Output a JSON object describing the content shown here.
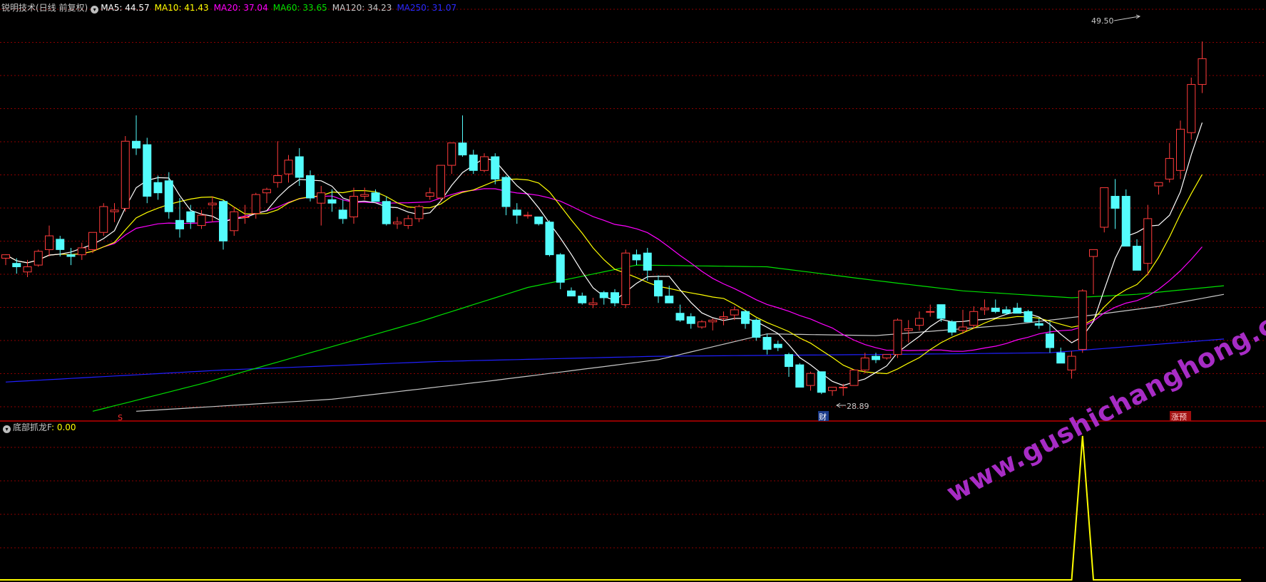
{
  "colors": {
    "up": "#ff3b3b",
    "down": "#54fcfc",
    "grid": "#8b0000",
    "ma5": "#ffffff",
    "ma10": "#ffff00",
    "ma20": "#ff00ff",
    "ma60": "#00e000",
    "ma120": "#c8c8c8",
    "ma250": "#2020ff",
    "indicator": "#ffff00",
    "watermark": "#b02fd0"
  },
  "header": {
    "title": "锐明技术(日线 前复权)",
    "ma5": "MA5: 44.57",
    "ma10": "MA10: 41.43",
    "ma20": "MA20: 37.04",
    "ma60": "MA60: 33.65",
    "ma120": "MA120: 34.23",
    "ma250": "MA250: 31.07"
  },
  "indicator_header": {
    "title": "底部抓龙F",
    "value": ": 0.00"
  },
  "annotations": {
    "high_label": "49.50",
    "low_label": "28.89",
    "marker_s": "S",
    "marker_cai": "财",
    "marker_zhangyu": "涨预"
  },
  "icons": {
    "header_toggle": "circle-down-icon",
    "indicator_toggle": "circle-down-icon"
  },
  "watermark": "www.gushichanghong.com",
  "chart_data": {
    "type": "candlestick",
    "price_range": [
      27.6,
      51.0
    ],
    "grid": true,
    "candles": [
      [
        36.9,
        37.1,
        36.5,
        37.1
      ],
      [
        36.6,
        36.9,
        36.0,
        36.4
      ],
      [
        36.1,
        36.8,
        35.8,
        36.4
      ],
      [
        36.5,
        37.4,
        36.4,
        37.3
      ],
      [
        37.4,
        38.8,
        37.0,
        38.2
      ],
      [
        38.0,
        38.2,
        37.0,
        37.4
      ],
      [
        37.1,
        37.5,
        36.5,
        37.0
      ],
      [
        37.1,
        37.8,
        36.8,
        37.5
      ],
      [
        37.4,
        38.4,
        37.2,
        38.4
      ],
      [
        38.4,
        40.1,
        38.2,
        39.9
      ],
      [
        39.6,
        40.1,
        39.0,
        39.7
      ],
      [
        39.8,
        44.0,
        39.6,
        43.7
      ],
      [
        43.7,
        45.2,
        42.9,
        43.3
      ],
      [
        43.5,
        43.9,
        40.1,
        40.5
      ],
      [
        41.3,
        41.7,
        40.3,
        40.7
      ],
      [
        41.4,
        41.9,
        39.2,
        39.6
      ],
      [
        39.1,
        40.4,
        38.1,
        38.6
      ],
      [
        39.6,
        40.0,
        38.6,
        39.0
      ],
      [
        38.8,
        39.7,
        38.6,
        39.4
      ],
      [
        40.0,
        40.5,
        39.0,
        40.1
      ],
      [
        40.2,
        40.3,
        37.4,
        37.9
      ],
      [
        38.5,
        39.9,
        38.2,
        39.6
      ],
      [
        39.3,
        40.0,
        38.9,
        39.3
      ],
      [
        39.5,
        40.7,
        39.2,
        40.6
      ],
      [
        40.7,
        41.0,
        40.1,
        40.9
      ],
      [
        41.3,
        43.7,
        41.0,
        41.7
      ],
      [
        41.8,
        42.9,
        41.3,
        42.6
      ],
      [
        42.8,
        43.3,
        41.1,
        41.6
      ],
      [
        41.7,
        42.0,
        40.2,
        40.4
      ],
      [
        40.1,
        41.1,
        38.8,
        40.7
      ],
      [
        40.3,
        40.9,
        39.6,
        40.1
      ],
      [
        39.7,
        40.3,
        38.9,
        39.2
      ],
      [
        39.3,
        41.0,
        38.9,
        40.5
      ],
      [
        40.5,
        41.0,
        40.3,
        40.6
      ],
      [
        40.7,
        40.9,
        40.2,
        40.2
      ],
      [
        40.2,
        40.5,
        38.8,
        38.9
      ],
      [
        38.9,
        39.3,
        38.6,
        39.0
      ],
      [
        38.8,
        39.4,
        38.6,
        39.2
      ],
      [
        39.2,
        40.0,
        39.0,
        39.9
      ],
      [
        40.5,
        41.0,
        40.3,
        40.7
      ],
      [
        40.4,
        42.3,
        40.2,
        42.3
      ],
      [
        42.3,
        43.2,
        41.8,
        43.6
      ],
      [
        43.6,
        45.2,
        42.8,
        42.9
      ],
      [
        42.9,
        43.2,
        41.8,
        42.0
      ],
      [
        42.0,
        43.0,
        41.9,
        42.8
      ],
      [
        42.8,
        43.0,
        41.2,
        41.5
      ],
      [
        41.6,
        41.7,
        39.4,
        39.9
      ],
      [
        39.7,
        40.1,
        38.9,
        39.4
      ],
      [
        39.4,
        39.6,
        39.2,
        39.4
      ],
      [
        39.3,
        39.3,
        38.8,
        38.9
      ],
      [
        39.0,
        39.1,
        37.0,
        37.1
      ],
      [
        37.1,
        37.2,
        35.1,
        35.5
      ],
      [
        35.0,
        35.2,
        34.8,
        34.7
      ],
      [
        34.7,
        34.9,
        34.2,
        34.3
      ],
      [
        34.2,
        34.6,
        34.0,
        34.3
      ],
      [
        34.9,
        35.0,
        34.2,
        34.6
      ],
      [
        34.9,
        35.1,
        34.1,
        34.3
      ],
      [
        34.2,
        37.4,
        34.0,
        37.2
      ],
      [
        37.1,
        37.4,
        36.5,
        36.8
      ],
      [
        37.2,
        37.5,
        35.6,
        36.2
      ],
      [
        35.6,
        35.9,
        34.3,
        34.7
      ],
      [
        34.7,
        35.3,
        34.3,
        34.3
      ],
      [
        33.7,
        34.2,
        33.2,
        33.3
      ],
      [
        33.5,
        33.7,
        32.8,
        33.1
      ],
      [
        32.9,
        33.3,
        32.8,
        33.2
      ],
      [
        33.2,
        33.4,
        32.7,
        33.3
      ],
      [
        33.4,
        33.8,
        33.0,
        33.5
      ],
      [
        33.6,
        34.1,
        33.3,
        33.9
      ],
      [
        33.8,
        33.9,
        32.8,
        33.1
      ],
      [
        33.3,
        33.4,
        32.1,
        32.3
      ],
      [
        32.3,
        32.5,
        31.3,
        31.6
      ],
      [
        31.9,
        32.1,
        31.5,
        31.7
      ],
      [
        31.3,
        31.4,
        30.0,
        30.6
      ],
      [
        30.7,
        30.8,
        29.5,
        29.4
      ],
      [
        29.5,
        30.3,
        29.2,
        30.2
      ],
      [
        30.3,
        30.3,
        29.0,
        29.1
      ],
      [
        29.2,
        29.4,
        28.9,
        29.4
      ],
      [
        29.4,
        29.6,
        28.9,
        29.4
      ],
      [
        29.5,
        30.3,
        29.5,
        30.4
      ],
      [
        30.4,
        31.4,
        30.2,
        31.1
      ],
      [
        31.2,
        31.4,
        30.8,
        31.0
      ],
      [
        31.1,
        31.3,
        31.0,
        31.3
      ],
      [
        31.3,
        33.4,
        31.1,
        33.3
      ],
      [
        32.7,
        33.3,
        32.0,
        32.8
      ],
      [
        33.0,
        33.8,
        32.7,
        33.4
      ],
      [
        33.8,
        34.2,
        33.5,
        33.8
      ],
      [
        34.2,
        34.2,
        33.2,
        33.4
      ],
      [
        33.2,
        33.3,
        32.4,
        32.6
      ],
      [
        32.7,
        33.9,
        32.5,
        32.9
      ],
      [
        33.0,
        34.1,
        32.8,
        33.8
      ],
      [
        33.9,
        34.5,
        33.6,
        34.0
      ],
      [
        34.0,
        34.5,
        33.7,
        33.8
      ],
      [
        33.9,
        34.1,
        33.6,
        33.7
      ],
      [
        34.0,
        34.3,
        33.7,
        33.7
      ],
      [
        33.8,
        33.9,
        33.2,
        33.2
      ],
      [
        33.1,
        33.4,
        32.8,
        33.0
      ],
      [
        32.5,
        33.2,
        31.4,
        31.7
      ],
      [
        31.4,
        31.7,
        30.8,
        30.8
      ],
      [
        30.4,
        31.5,
        29.9,
        31.2
      ],
      [
        31.6,
        35.1,
        31.4,
        35.0
      ],
      [
        37.0,
        37.4,
        34.8,
        37.4
      ],
      [
        38.7,
        41.0,
        38.4,
        41.0
      ],
      [
        40.5,
        41.5,
        38.6,
        39.8
      ],
      [
        40.5,
        40.9,
        37.6,
        37.6
      ],
      [
        37.6,
        38.0,
        36.2,
        36.2
      ],
      [
        36.6,
        40.0,
        35.9,
        39.2
      ],
      [
        41.1,
        41.3,
        40.6,
        41.3
      ],
      [
        41.5,
        43.6,
        41.3,
        42.7
      ],
      [
        42.0,
        44.9,
        41.5,
        44.4
      ],
      [
        44.2,
        47.4,
        43.8,
        47.0
      ],
      [
        47.0,
        49.5,
        46.5,
        48.5
      ]
    ],
    "ma_series": {
      "MA5": "derived from candle closes (5-day mean)",
      "MA10": "derived from candle closes (10-day mean)",
      "MA20": "derived from candle closes (20-day mean)",
      "MA60": [
        [
          8,
          28.0
        ],
        [
          18,
          29.6
        ],
        [
          28,
          31.4
        ],
        [
          38,
          33.2
        ],
        [
          48,
          35.2
        ],
        [
          58,
          36.5
        ],
        [
          70,
          36.4
        ],
        [
          80,
          35.6
        ],
        [
          88,
          35.0
        ],
        [
          98,
          34.6
        ],
        [
          104,
          34.8
        ],
        [
          112,
          35.3
        ]
      ],
      "MA120": [
        [
          12,
          28.0
        ],
        [
          30,
          28.7
        ],
        [
          45,
          29.8
        ],
        [
          60,
          31.0
        ],
        [
          70,
          32.5
        ],
        [
          80,
          32.4
        ],
        [
          92,
          33.0
        ],
        [
          100,
          33.6
        ],
        [
          106,
          34.1
        ],
        [
          112,
          34.8
        ]
      ],
      "MA250": [
        [
          0,
          29.7
        ],
        [
          20,
          30.4
        ],
        [
          40,
          30.9
        ],
        [
          60,
          31.2
        ],
        [
          80,
          31.3
        ],
        [
          96,
          31.4
        ],
        [
          104,
          31.8
        ],
        [
          112,
          32.2
        ]
      ]
    },
    "indicator": {
      "name": "底部抓龙F",
      "range": [
        0,
        1
      ],
      "values_nonzero": [
        [
          99,
          1
        ]
      ]
    }
  }
}
